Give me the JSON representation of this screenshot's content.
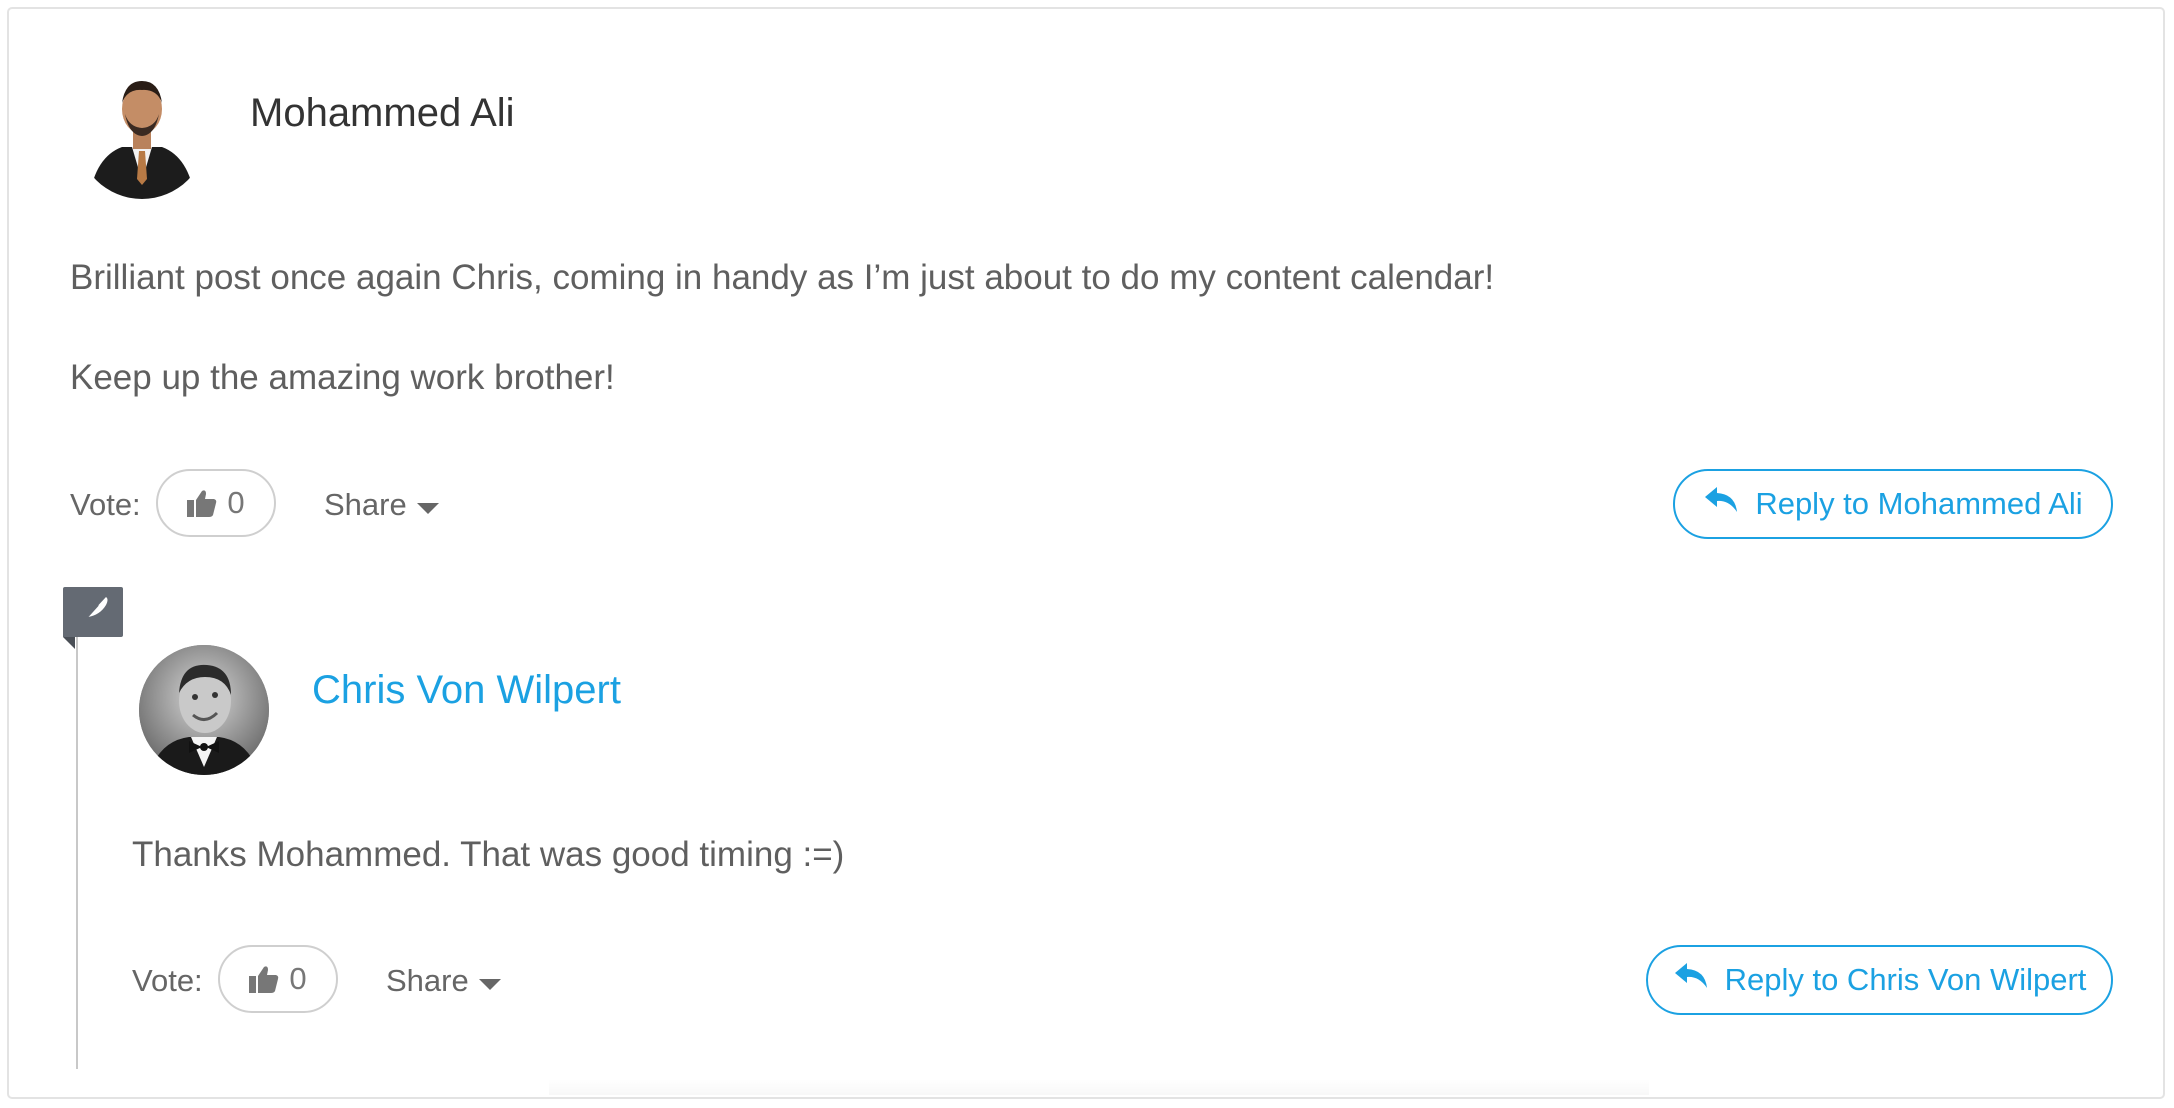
{
  "comments": [
    {
      "author": "Mohammed Ali",
      "paragraphs": [
        "Brilliant post once again Chris, coming in handy as I’m just about to do my content calendar!",
        "Keep up the amazing work brother!"
      ],
      "vote_label": "Vote:",
      "vote_count": "0",
      "share_label": "Share",
      "reply_label": "Reply to Mohammed Ali"
    },
    {
      "author": "Chris Von Wilpert",
      "is_post_author": true,
      "paragraphs": [
        "Thanks Mohammed. That was good timing :=)"
      ],
      "vote_label": "Vote:",
      "vote_count": "0",
      "share_label": "Share",
      "reply_label": "Reply to Chris Von Wilpert"
    }
  ],
  "icons": {
    "thumbs_up": "thumbs-up-icon",
    "share_caret": "caret-down-icon",
    "reply": "reply-arrow-icon",
    "author_badge": "feather-icon"
  },
  "colors": {
    "accent": "#1ba1e2",
    "text": "#5f5f5f",
    "badge": "#646a73"
  }
}
